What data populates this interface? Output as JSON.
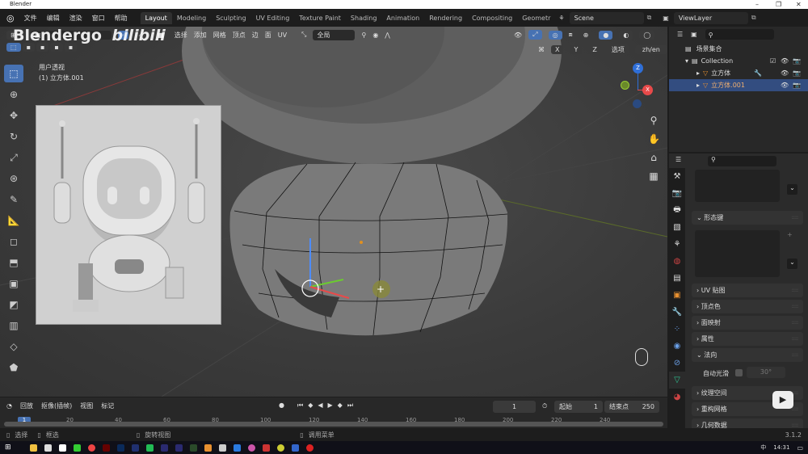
{
  "window": {
    "title": "Blender",
    "minimize": "–",
    "maximize": "❐",
    "close": "✕"
  },
  "watermark": {
    "text": "Blendergo",
    "logo": "bilibili"
  },
  "menu": [
    "文件",
    "编辑",
    "渲染",
    "窗口",
    "帮助"
  ],
  "workspaces": [
    {
      "label": "Layout",
      "active": true
    },
    {
      "label": "Modeling"
    },
    {
      "label": "Sculpting"
    },
    {
      "label": "UV Editing"
    },
    {
      "label": "Texture Paint"
    },
    {
      "label": "Shading"
    },
    {
      "label": "Animation"
    },
    {
      "label": "Rendering"
    },
    {
      "label": "Compositing"
    },
    {
      "label": "Geometr"
    }
  ],
  "scene": "Scene",
  "view_layer": "ViewLayer",
  "viewport_header": {
    "menus": [
      "选择",
      "添加",
      "网格",
      "顶点",
      "边",
      "面",
      "UV"
    ],
    "transform_orientation": "全局",
    "options": "选项",
    "lang": "zh/en",
    "axes": [
      "X",
      "Y",
      "Z"
    ]
  },
  "viewport": {
    "view_name": "用户透视",
    "object_name": "(1) 立方体.001",
    "accent": "#4772b3"
  },
  "gizmo": {
    "z": "Z",
    "x": "X"
  },
  "outliner": {
    "root": "场景集合",
    "collection": "Collection",
    "objects": [
      {
        "name": "立方体",
        "selected": false
      },
      {
        "name": "立方体.001",
        "selected": true
      }
    ]
  },
  "properties": {
    "panels": [
      {
        "label": "形态键",
        "expanded": true
      },
      {
        "label": "UV 贴图",
        "expanded": false
      },
      {
        "label": "顶点色",
        "expanded": false
      },
      {
        "label": "面映射",
        "expanded": false
      },
      {
        "label": "属性",
        "expanded": false
      },
      {
        "label": "法向",
        "expanded": true
      },
      {
        "label": "纹理空间",
        "expanded": false
      },
      {
        "label": "重构网格",
        "expanded": false
      },
      {
        "label": "几何数据",
        "expanded": false
      }
    ],
    "auto_smooth_label": "自动光滑",
    "auto_smooth_angle": "30°"
  },
  "timeline": {
    "menus": [
      "回放",
      "抠像(插帧)",
      "视图",
      "标记"
    ],
    "current_frame": "1",
    "start_label": "起始",
    "start": "1",
    "end_label": "结束点",
    "end": "250",
    "ticks": [
      "1",
      "20",
      "40",
      "60",
      "80",
      "100",
      "120",
      "140",
      "160",
      "180",
      "200",
      "220",
      "240"
    ]
  },
  "status": {
    "items": [
      "选择",
      "框选",
      "旋转视图",
      "调用菜单"
    ],
    "version": "3.1.2"
  },
  "taskbar": {
    "time": "14:31",
    "ime": "中"
  }
}
